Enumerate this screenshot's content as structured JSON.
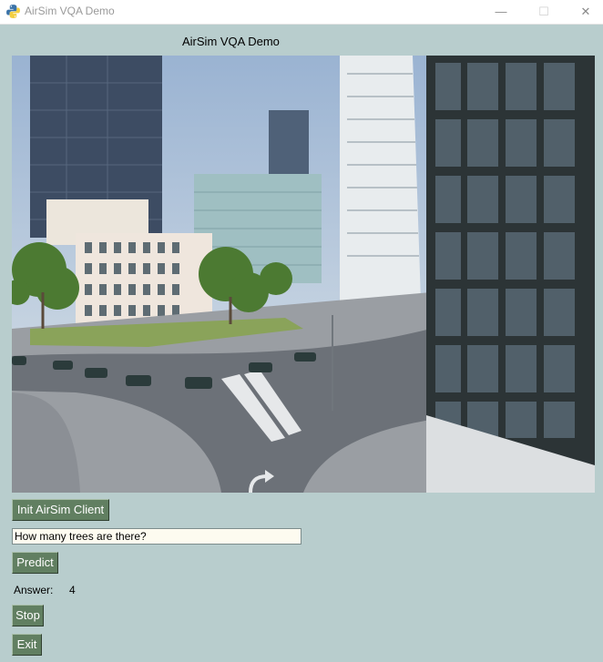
{
  "window": {
    "title": "AirSim VQA Demo",
    "minimize_glyph": "—",
    "maximize_glyph": "☐",
    "close_glyph": "✕"
  },
  "app": {
    "heading": "AirSim VQA Demo"
  },
  "camera_view": {
    "icon": "city-street-camera-image"
  },
  "controls": {
    "init_label": "Init AirSim Client",
    "question_value": "How many trees are there?",
    "predict_label": "Predict",
    "answer_label": "Answer:",
    "answer_value": "4",
    "stop_label": "Stop",
    "exit_label": "Exit"
  },
  "colors": {
    "background": "#b8cdcd",
    "button": "#617f61",
    "input_background": "#fdfbf0"
  }
}
